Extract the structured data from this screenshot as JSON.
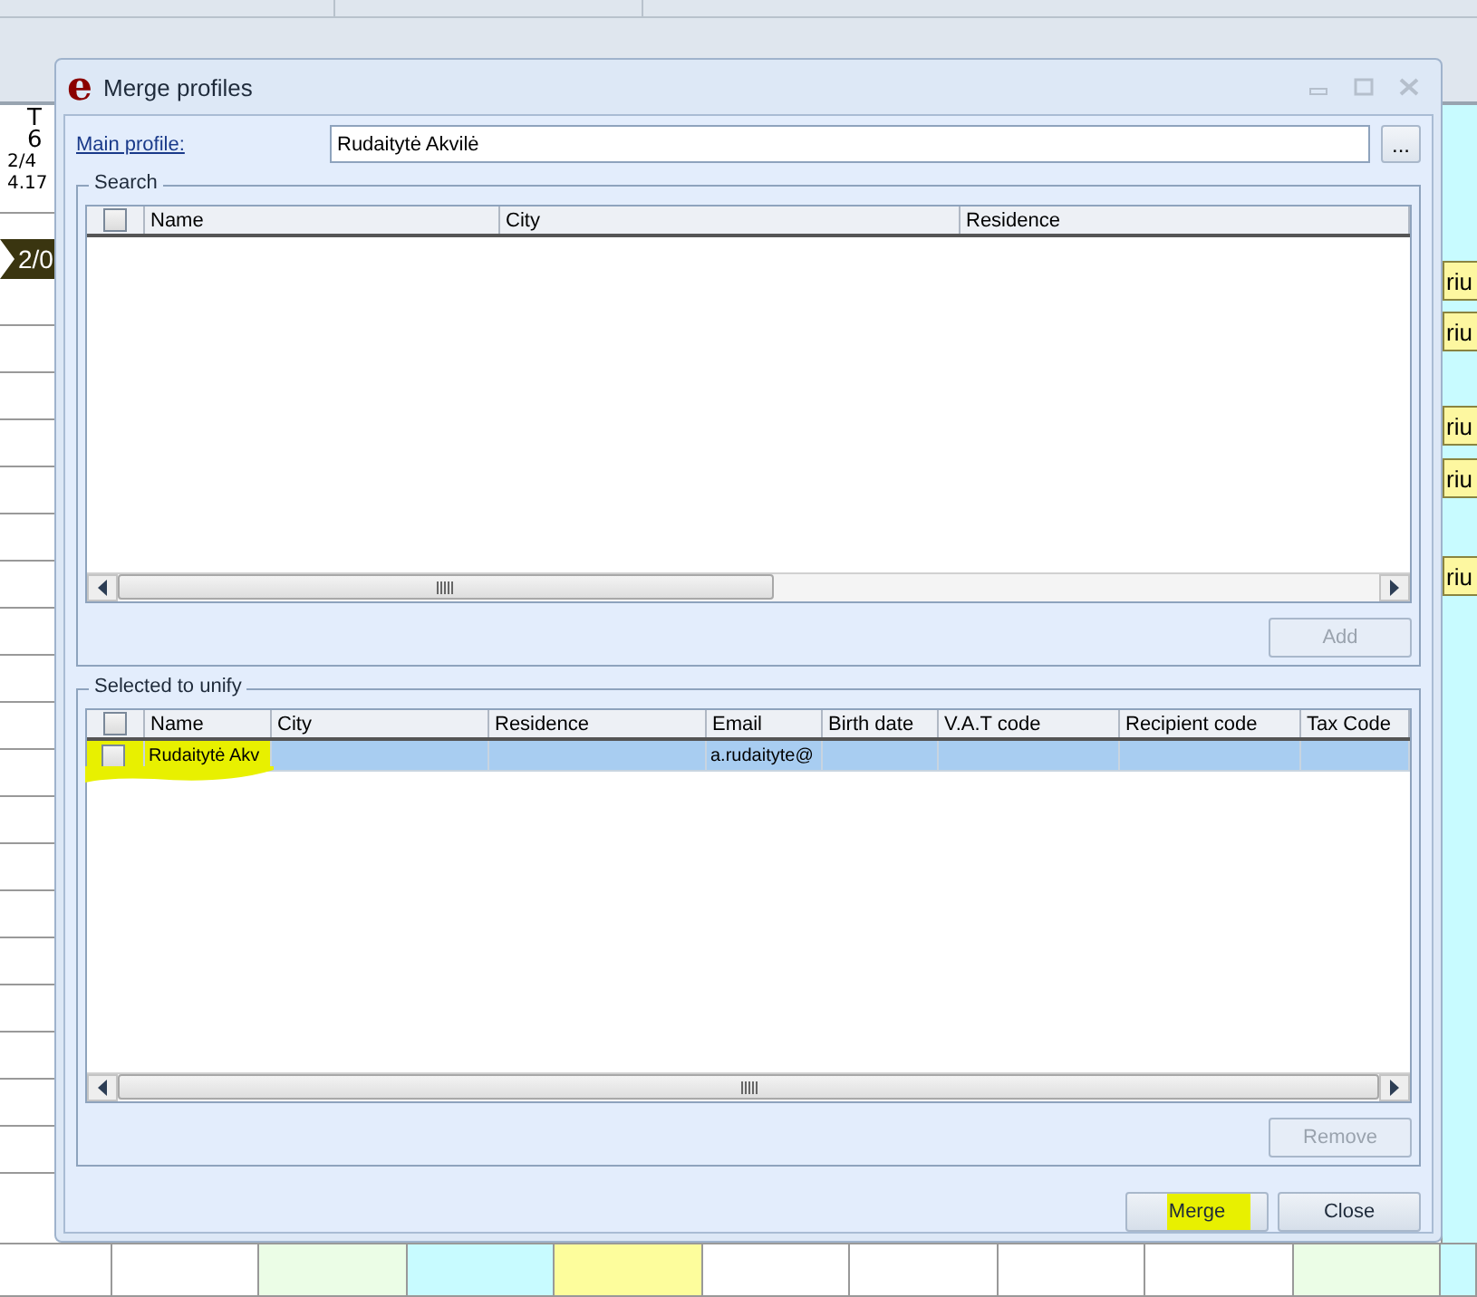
{
  "background": {
    "left_cell": [
      "T",
      "6",
      "2/4",
      "4.17"
    ],
    "left_tag": "2/0",
    "right_tags": [
      "riu",
      "riu",
      "riu",
      "riu",
      "riu"
    ]
  },
  "dialog": {
    "logo": "e",
    "title": "Merge profiles",
    "main_profile": {
      "label": "Main profile:",
      "value": "Rudaitytė Akvilė",
      "browse": "..."
    },
    "search": {
      "legend": "Search",
      "header_checked": false,
      "columns": [
        "Name",
        "City",
        "Residence"
      ],
      "add": {
        "label": "Add",
        "disabled": true
      }
    },
    "selected": {
      "legend": "Selected to unify",
      "header_checked": false,
      "columns": [
        "Name",
        "City",
        "Residence",
        "Email",
        "Birth date",
        "V.A.T code",
        "Recipient code",
        "Tax Code"
      ],
      "rows": [
        {
          "selected": true,
          "checked": false,
          "name": "Rudaitytė Akv",
          "email": "a.rudaityte@"
        }
      ],
      "remove": {
        "label": "Remove",
        "disabled": true
      }
    },
    "buttons": [
      {
        "label": "Merge",
        "disabled": false
      },
      {
        "label": "Close",
        "disabled": false
      }
    ]
  }
}
